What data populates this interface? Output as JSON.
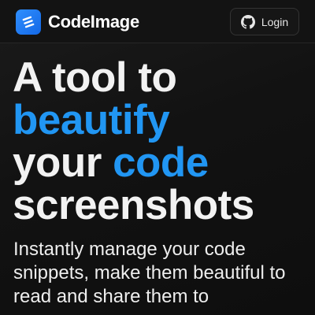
{
  "colors": {
    "accent": "#2196f3",
    "background": "#111111",
    "text": "#f2f2f2"
  },
  "header": {
    "brand": {
      "name": "CodeImage",
      "logo_icon": "codeimage-logo-icon"
    },
    "login": {
      "label": "Login",
      "icon": "github-icon"
    }
  },
  "hero": {
    "title": {
      "line1": "A tool to",
      "line2_accent": "beautify",
      "line3_plain": "your ",
      "line3_accent": "code",
      "line4": "screenshots"
    },
    "subtitle": "Instantly manage your code snippets, make them beautiful to read and share them to"
  }
}
